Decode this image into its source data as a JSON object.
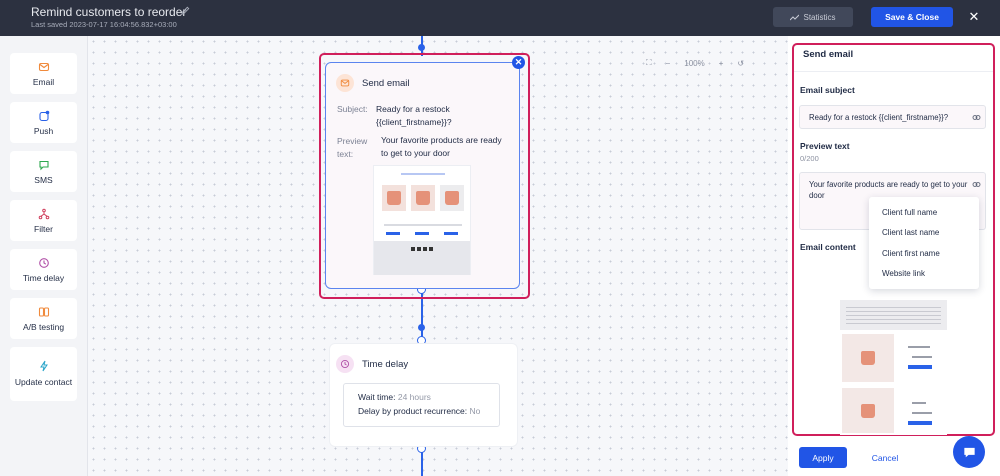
{
  "header": {
    "title": "Remind customers to reorder",
    "last_saved": "Last saved 2023-07-17 16:04:56.832+03:00",
    "statistics_label": "Statistics",
    "save_close_label": "Save & Close"
  },
  "palette": {
    "items": [
      {
        "label": "Email",
        "icon": "mail-icon",
        "color": "#f08a3c"
      },
      {
        "label": "Push",
        "icon": "push-icon",
        "color": "#2a62e8"
      },
      {
        "label": "SMS",
        "icon": "chat-bubble-icon",
        "color": "#2ea84f"
      },
      {
        "label": "Filter",
        "icon": "filter-icon",
        "color": "#d0405e"
      },
      {
        "label": "Time delay",
        "icon": "clock-icon",
        "color": "#b04fa7"
      },
      {
        "label": "A/B testing",
        "icon": "ab-icon",
        "color": "#f08a3c"
      },
      {
        "label": "Update contact",
        "icon": "bolt-icon",
        "color": "#2aa5c9"
      }
    ]
  },
  "canvas": {
    "zoom": "100%",
    "email_node": {
      "title": "Send email",
      "subject_label": "Subject:",
      "subject_value": "Ready for a restock {{client_firstname}}?",
      "preview_label": "Preview text:",
      "preview_value": "Your favorite products are ready to get to your door"
    },
    "delay_node": {
      "title": "Time delay",
      "wait_label": "Wait time:",
      "wait_value": "24 hours",
      "recurrence_label": "Delay by product recurrence:",
      "recurrence_value": "No"
    }
  },
  "panel": {
    "title": "Send email",
    "subject_label": "Email subject",
    "subject_value": "Ready for a restock {{client_firstname}}?",
    "preview_label": "Preview text",
    "preview_counter": "0/200",
    "preview_value": "Your favorite products are ready to get to your door",
    "content_label": "Email content",
    "personalization_options": [
      "Client full name",
      "Client last name",
      "Client first name",
      "Website link"
    ],
    "apply_label": "Apply",
    "cancel_label": "Cancel"
  },
  "colors": {
    "accent": "#2155e6",
    "highlight": "#d01f5b",
    "header_bg": "#2c3140"
  }
}
